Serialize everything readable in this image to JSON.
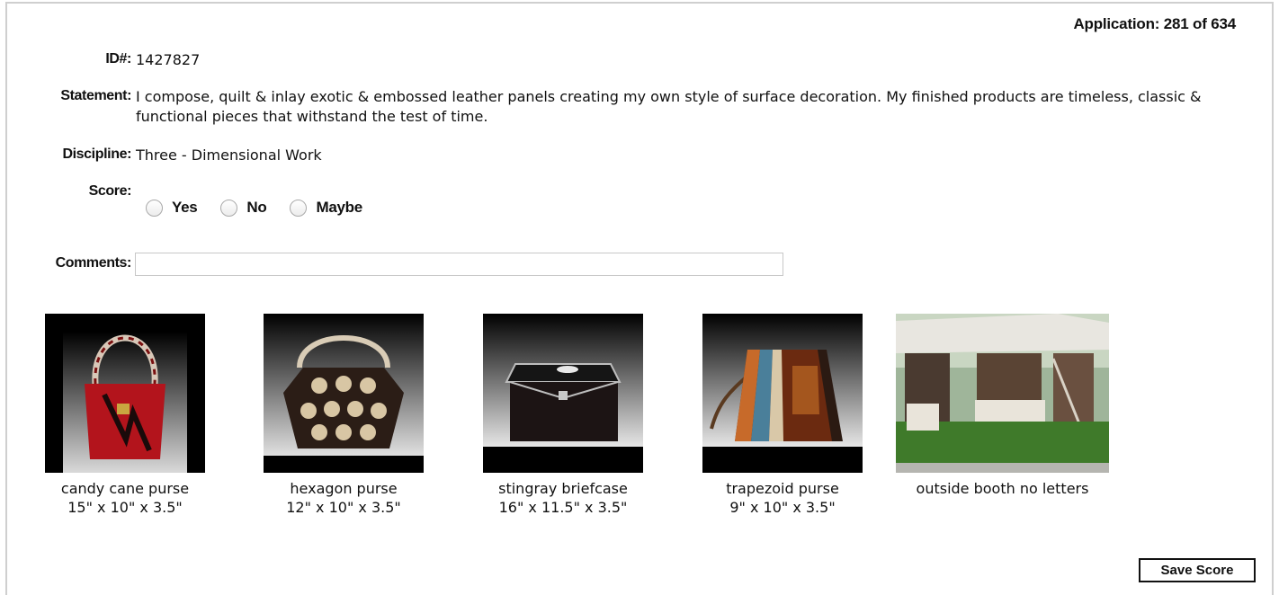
{
  "header": {
    "application_counter": "Application: 281 of 634"
  },
  "fields": {
    "id_label": "ID#:",
    "id_value": "1427827",
    "statement_label": "Statement:",
    "statement_value": "I compose, quilt & inlay exotic & embossed leather panels creating my own style of surface decoration. My finished products are timeless, classic & functional pieces that withstand the test of time.",
    "discipline_label": "Discipline:",
    "discipline_value": "Three - Dimensional Work",
    "score_label": "Score:",
    "score_options": [
      "Yes",
      "No",
      "Maybe"
    ],
    "comments_label": "Comments:",
    "comments_value": ""
  },
  "images": [
    {
      "title": "candy cane purse",
      "dimensions": "15\" x 10\" x 3.5\""
    },
    {
      "title": "hexagon purse",
      "dimensions": "12\" x 10\" x 3.5\""
    },
    {
      "title": "stingray briefcase",
      "dimensions": "16\" x 11.5\" x 3.5\""
    },
    {
      "title": "trapezoid purse",
      "dimensions": "9\" x 10\" x 3.5\""
    },
    {
      "title": "outside booth no letters",
      "dimensions": ""
    }
  ],
  "actions": {
    "save_label": "Save Score"
  }
}
